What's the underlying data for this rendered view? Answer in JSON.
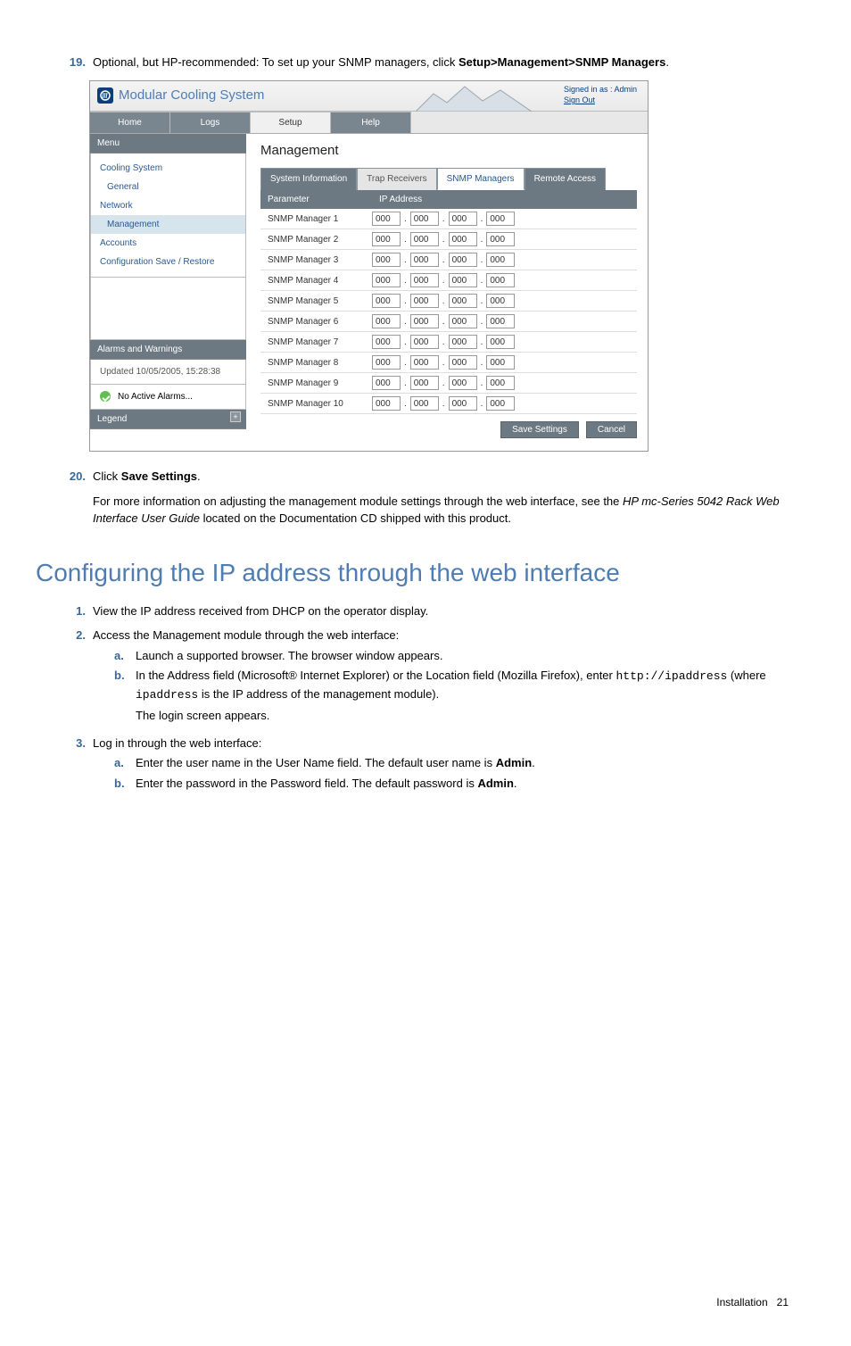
{
  "steps": {
    "s19": {
      "num": "19.",
      "before": "Optional, but HP-recommended: To set up your SNMP managers, click ",
      "bold": "Setup>Management>SNMP Managers",
      "after": "."
    },
    "s20": {
      "num": "20.",
      "before": "Click ",
      "bold": "Save Settings",
      "after": "."
    }
  },
  "para1": {
    "before": "For more information on adjusting the management module settings through the web interface, see the ",
    "italic": "HP mc-Series 5042 Rack Web Interface User Guide",
    "after": " located on the Documentation CD shipped with this product."
  },
  "heading": "Configuring the IP address through the web interface",
  "list": {
    "i1": {
      "num": "1.",
      "text": "View the IP address received from DHCP on the operator display."
    },
    "i2": {
      "num": "2.",
      "text": "Access the Management module through the web interface:"
    },
    "i2a": {
      "num": "a.",
      "text": "Launch a supported browser. The browser window appears."
    },
    "i2b": {
      "num": "b.",
      "t1": "In the Address field (Microsoft® Internet Explorer) or the Location field (Mozilla Firefox), enter ",
      "code": "http://ipaddress",
      "t2": " (where ",
      "code2": "ipaddress",
      "t3": " is the IP address of the management module).",
      "t4": "The login screen appears."
    },
    "i3": {
      "num": "3.",
      "text": "Log in through the web interface:"
    },
    "i3a": {
      "num": "a.",
      "t1": "Enter the user name in the User Name field. The default user name is ",
      "bold": "Admin",
      "t2": "."
    },
    "i3b": {
      "num": "b.",
      "t1": "Enter the password in the Password field. The default password is ",
      "bold": "Admin",
      "t2": "."
    }
  },
  "footer": {
    "label": "Installation",
    "page": "21"
  },
  "app": {
    "title": "Modular Cooling System",
    "signin": {
      "line": "Signed in as : Admin",
      "link": "Sign Out"
    },
    "topnav": {
      "home": "Home",
      "logs": "Logs",
      "setup": "Setup",
      "help": "Help"
    },
    "menu": {
      "header": "Menu",
      "items": {
        "cooling": "Cooling System",
        "general": "General",
        "network": "Network",
        "management": "Management",
        "accounts": "Accounts",
        "config": "Configuration Save / Restore"
      }
    },
    "alarms": {
      "header": "Alarms and Warnings",
      "updated": "Updated 10/05/2005, 15:28:38",
      "noalarm": "No Active Alarms..."
    },
    "legend": {
      "header": "Legend"
    },
    "main": {
      "title": "Management",
      "subtabs": {
        "sysinfo": "System Information",
        "trap": "Trap Receivers",
        "snmp": "SNMP Managers",
        "remote": "Remote Access"
      },
      "cols": {
        "param": "Parameter",
        "ip": "IP Address"
      },
      "rows": [
        {
          "label": "SNMP Manager 1",
          "oct": [
            "000",
            "000",
            "000",
            "000"
          ]
        },
        {
          "label": "SNMP Manager 2",
          "oct": [
            "000",
            "000",
            "000",
            "000"
          ]
        },
        {
          "label": "SNMP Manager 3",
          "oct": [
            "000",
            "000",
            "000",
            "000"
          ]
        },
        {
          "label": "SNMP Manager 4",
          "oct": [
            "000",
            "000",
            "000",
            "000"
          ]
        },
        {
          "label": "SNMP Manager 5",
          "oct": [
            "000",
            "000",
            "000",
            "000"
          ]
        },
        {
          "label": "SNMP Manager 6",
          "oct": [
            "000",
            "000",
            "000",
            "000"
          ]
        },
        {
          "label": "SNMP Manager 7",
          "oct": [
            "000",
            "000",
            "000",
            "000"
          ]
        },
        {
          "label": "SNMP Manager 8",
          "oct": [
            "000",
            "000",
            "000",
            "000"
          ]
        },
        {
          "label": "SNMP Manager 9",
          "oct": [
            "000",
            "000",
            "000",
            "000"
          ]
        },
        {
          "label": "SNMP Manager 10",
          "oct": [
            "000",
            "000",
            "000",
            "000"
          ]
        }
      ],
      "buttons": {
        "save": "Save Settings",
        "cancel": "Cancel"
      }
    }
  }
}
